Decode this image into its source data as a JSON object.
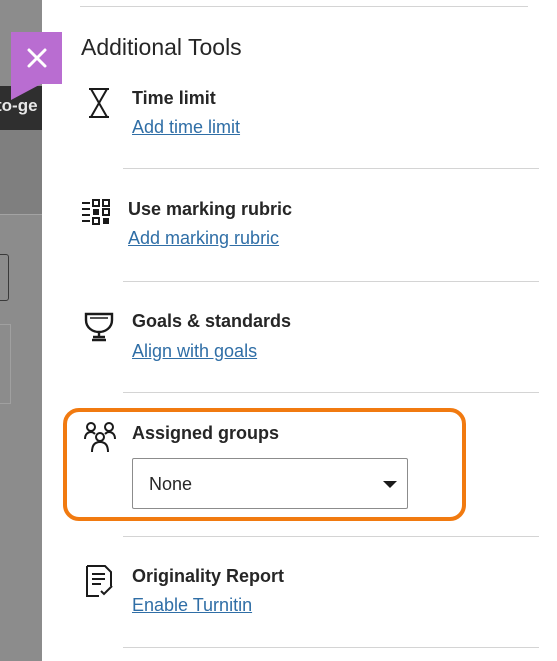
{
  "backdrop": {
    "snippet_text": "to-ge"
  },
  "panel": {
    "close_label": "Close",
    "section_title": "Additional Tools",
    "tools": [
      {
        "name": "Time limit",
        "link": "Add time limit",
        "icon": "hourglass-icon"
      },
      {
        "name": "Use marking rubric",
        "link": "Add marking rubric",
        "icon": "rubric-grid-icon"
      },
      {
        "name": "Goals & standards",
        "link": "Align with goals",
        "icon": "trophy-icon"
      },
      {
        "name": "Assigned groups",
        "icon": "groups-icon",
        "select_value": "None"
      },
      {
        "name": "Originality Report",
        "link": "Enable Turnitin",
        "icon": "report-check-icon"
      }
    ]
  },
  "colors": {
    "accent_close": "#b96dd1",
    "highlight": "#f17a10",
    "link": "#2f6ea6"
  }
}
